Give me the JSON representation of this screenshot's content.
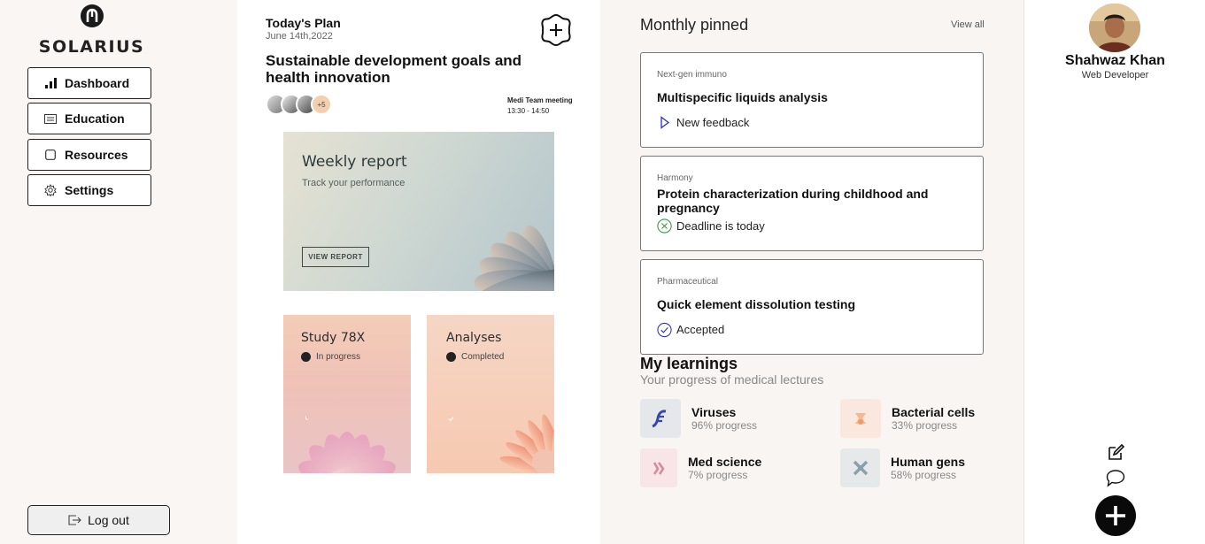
{
  "sidebar": {
    "brand": "SOLARIUS",
    "nav": [
      {
        "label": "Dashboard",
        "icon": "bar-chart-icon"
      },
      {
        "label": "Education",
        "icon": "list-icon"
      },
      {
        "label": "Resources",
        "icon": "square-icon"
      },
      {
        "label": "Settings",
        "icon": "gear-icon"
      }
    ],
    "logout_label": "Log out"
  },
  "plan": {
    "title": "Today's Plan",
    "date": "June 14th,2022",
    "headline": "Sustainable development goals and health innovation",
    "extra_participants": "+5",
    "meeting_title": "Medi Team meeting",
    "meeting_time": "13:30 - 14:50"
  },
  "weekly_report": {
    "title": "Weekly report",
    "subtitle": "Track your performance",
    "button": "VIEW REPORT"
  },
  "cards": [
    {
      "title": "Study 78X",
      "status": "In progress"
    },
    {
      "title": "Analyses",
      "status": "Completed"
    }
  ],
  "pinned": {
    "title": "Monthly pinned",
    "view_all": "View all",
    "items": [
      {
        "category": "Next-gen immuno",
        "title": "Multispecific liquids analysis",
        "status": "New feedback",
        "status_icon": "play-icon",
        "status_color": "#2b2bd6"
      },
      {
        "category": "Harmony",
        "title": "Protein characterization during childhood and pregnancy",
        "status": "Deadline is today",
        "status_icon": "x-circle-icon",
        "status_color": "#2ea043"
      },
      {
        "category": "Pharmaceutical",
        "title": "Quick element dissolution testing",
        "status": "Accepted",
        "status_icon": "check-circle-icon",
        "status_color": "#2b2bd6"
      }
    ]
  },
  "learnings": {
    "title": "My learnings",
    "subtitle": "Your progress of medical lectures",
    "items": [
      {
        "name": "Viruses",
        "progress": "96% progress",
        "progress_value": 96
      },
      {
        "name": "Bacterial cells",
        "progress": "33% progress",
        "progress_value": 33
      },
      {
        "name": "Med science",
        "progress": "7% progress",
        "progress_value": 7
      },
      {
        "name": "Human gens",
        "progress": "58% progress",
        "progress_value": 58
      }
    ]
  },
  "profile": {
    "name": "Shahwaz Khan",
    "role": "Web Developer"
  }
}
